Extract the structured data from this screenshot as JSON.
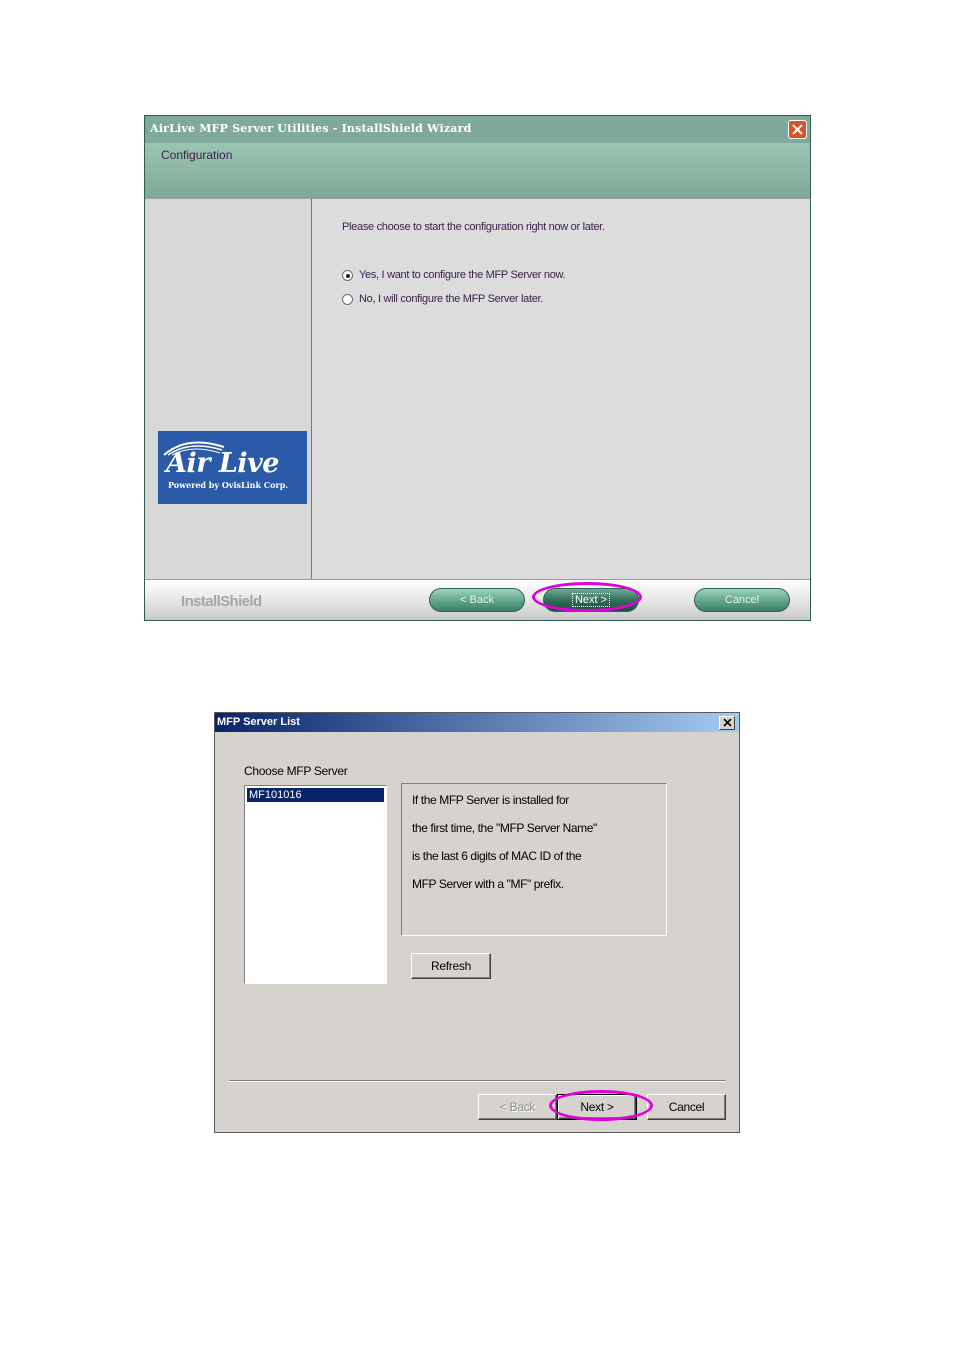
{
  "wizard": {
    "title": "AirLive MFP Server Utilities - InstallShield Wizard",
    "header_title": "Configuration",
    "prompt": "Please choose to start the configuration right now or later.",
    "options": [
      {
        "label": "Yes, I want to configure the MFP Server now.",
        "selected": true
      },
      {
        "label": "No, I will configure the MFP Server later.",
        "selected": false
      }
    ],
    "logo": {
      "main": "Air Live",
      "tagline": "Powered by OvisLink Corp."
    },
    "brand": "InstallShield",
    "buttons": {
      "back": "< Back",
      "next": "Next >",
      "cancel": "Cancel"
    },
    "highlighted_button": "next"
  },
  "server_list": {
    "title": "MFP Server List",
    "choose_label": "Choose MFP Server",
    "servers": [
      "MF101016"
    ],
    "selected_server": "MF101016",
    "info_lines": [
      "If the MFP Server is installed for",
      "the first time, the \"MFP Server Name\"",
      "is the last 6 digits of MAC ID of the",
      "MFP Server with a \"MF\" prefix."
    ],
    "refresh_label": "Refresh",
    "buttons": {
      "back": "< Back",
      "next": "Next >",
      "cancel": "Cancel"
    },
    "highlighted_button": "next"
  },
  "colors": {
    "wizard_title_bg": "#7fa998",
    "highlight_ellipse": "#e000d8",
    "logo_bg": "#2a5aa8",
    "classic_title_start": "#0a246a",
    "classic_title_end": "#a6caf0"
  },
  "icons": {
    "close": "close-icon",
    "radio_on": "radio-selected-icon",
    "radio_off": "radio-unselected-icon"
  }
}
